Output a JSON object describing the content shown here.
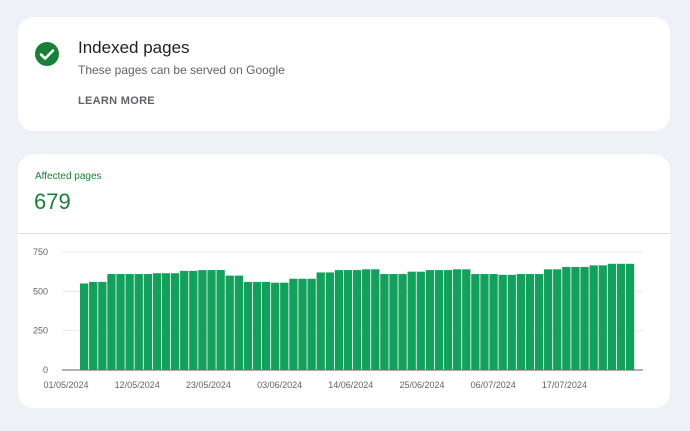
{
  "status_card": {
    "icon": "check-circle-icon",
    "title": "Indexed pages",
    "subtitle": "These pages can be served on Google",
    "learn_more": "LEARN MORE"
  },
  "metric": {
    "label": "Affected pages",
    "value": "679"
  },
  "colors": {
    "accent_green": "#188038",
    "bar_green": "#12a05c",
    "check_green": "#188038"
  },
  "chart_data": {
    "type": "bar",
    "title": "",
    "xlabel": "",
    "ylabel": "",
    "ylim": [
      0,
      750
    ],
    "y_ticks": [
      "0",
      "250",
      "500",
      "750"
    ],
    "x_ticks": [
      "01/05/2024",
      "12/05/2024",
      "23/05/2024",
      "03/06/2024",
      "14/06/2024",
      "25/06/2024",
      "06/07/2024",
      "17/07/2024"
    ],
    "grid": true,
    "series": [
      {
        "values": [
          550,
          560,
          560,
          610,
          610,
          610,
          610,
          610,
          615,
          615,
          615,
          630,
          630,
          635,
          635,
          635,
          600,
          600,
          560,
          560,
          560,
          555,
          555,
          580,
          580,
          580,
          620,
          620,
          635,
          635,
          635,
          640,
          640,
          610,
          610,
          610,
          625,
          625,
          635,
          635,
          635,
          640,
          640,
          610,
          610,
          610,
          605,
          605,
          610,
          610,
          610,
          640,
          640,
          655,
          655,
          655,
          665,
          665,
          675,
          675,
          675
        ]
      }
    ]
  }
}
